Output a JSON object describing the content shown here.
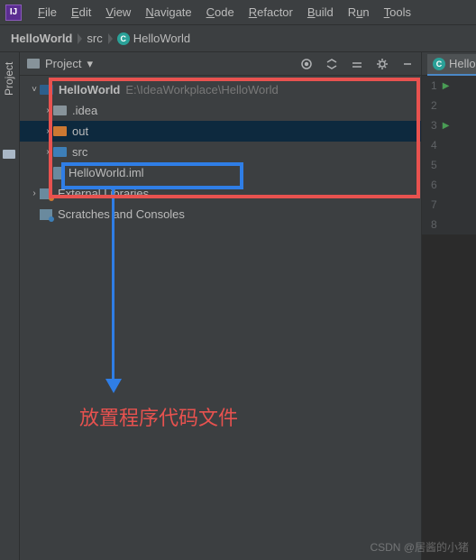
{
  "menu": [
    "File",
    "Edit",
    "View",
    "Navigate",
    "Code",
    "Refactor",
    "Build",
    "Run",
    "Tools"
  ],
  "breadcrumb": {
    "root": "HelloWorld",
    "folder": "src",
    "file": "HelloWorld"
  },
  "panel": {
    "title": "Project",
    "rail_label": "Project"
  },
  "tree": {
    "project_name": "HelloWorld",
    "project_path": "E:\\IdeaWorkplace\\HelloWorld",
    "idea": ".idea",
    "out": "out",
    "src": "src",
    "iml": "HelloWorld.iml",
    "ext_lib": "External Libraries",
    "scratch": "Scratches and Consoles"
  },
  "editor": {
    "tab_label": "Hello",
    "lines": [
      1,
      2,
      3,
      4,
      5,
      6,
      7,
      8
    ],
    "run_lines": [
      1,
      3
    ]
  },
  "annotation_text": "放置程序代码文件",
  "watermark": "CSDN @居酱的小猪"
}
